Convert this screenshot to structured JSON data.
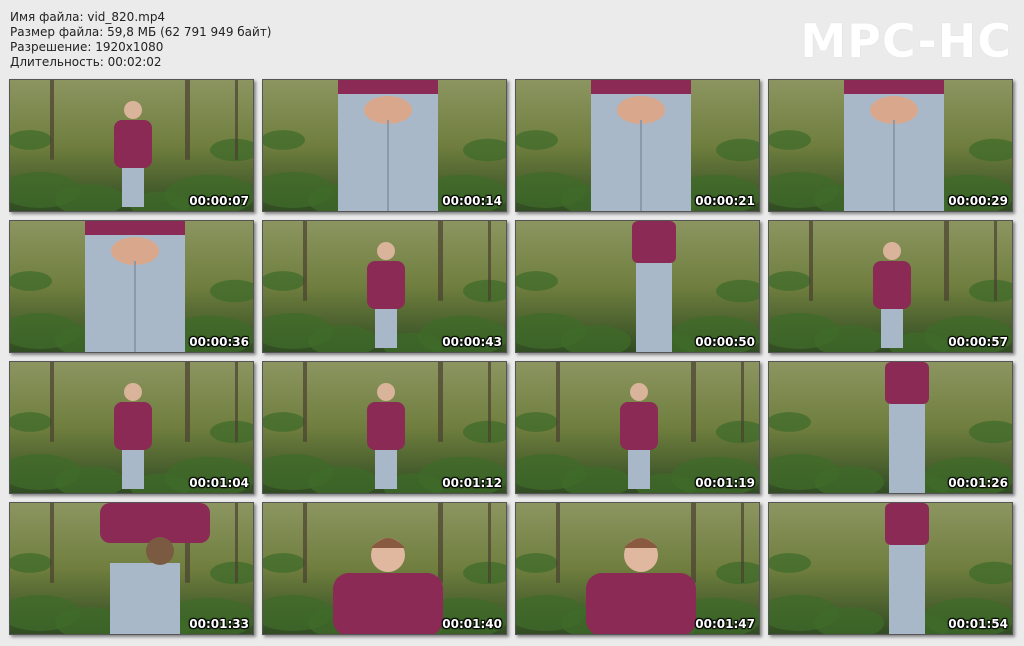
{
  "info": {
    "filename": "Имя файла: vid_820.mp4",
    "filesize": "Размер файла: 59,8 МБ (62 791 949 байт)",
    "resolution": "Разрешение: 1920x1080",
    "duration": "Длительность: 00:02:02"
  },
  "logo": "MPC-HC",
  "thumbnails": [
    {
      "time": "00:00:07",
      "shot": "wide"
    },
    {
      "time": "00:00:14",
      "shot": "closeup"
    },
    {
      "time": "00:00:21",
      "shot": "closeup"
    },
    {
      "time": "00:00:29",
      "shot": "closeup"
    },
    {
      "time": "00:00:36",
      "shot": "closeup"
    },
    {
      "time": "00:00:43",
      "shot": "wide"
    },
    {
      "time": "00:00:50",
      "shot": "back"
    },
    {
      "time": "00:00:57",
      "shot": "wide"
    },
    {
      "time": "00:01:04",
      "shot": "wide"
    },
    {
      "time": "00:01:12",
      "shot": "wide"
    },
    {
      "time": "00:01:19",
      "shot": "wide"
    },
    {
      "time": "00:01:26",
      "shot": "back"
    },
    {
      "time": "00:01:33",
      "shot": "bent"
    },
    {
      "time": "00:01:40",
      "shot": "portrait"
    },
    {
      "time": "00:01:47",
      "shot": "portrait"
    },
    {
      "time": "00:01:54",
      "shot": "back"
    }
  ],
  "colors": {
    "background": "#ebebeb",
    "forest_light": "#7d8a4a",
    "forest_dark": "#2f4a22",
    "jacket": "#8a2a55",
    "jeans": "#a9b8c8"
  }
}
